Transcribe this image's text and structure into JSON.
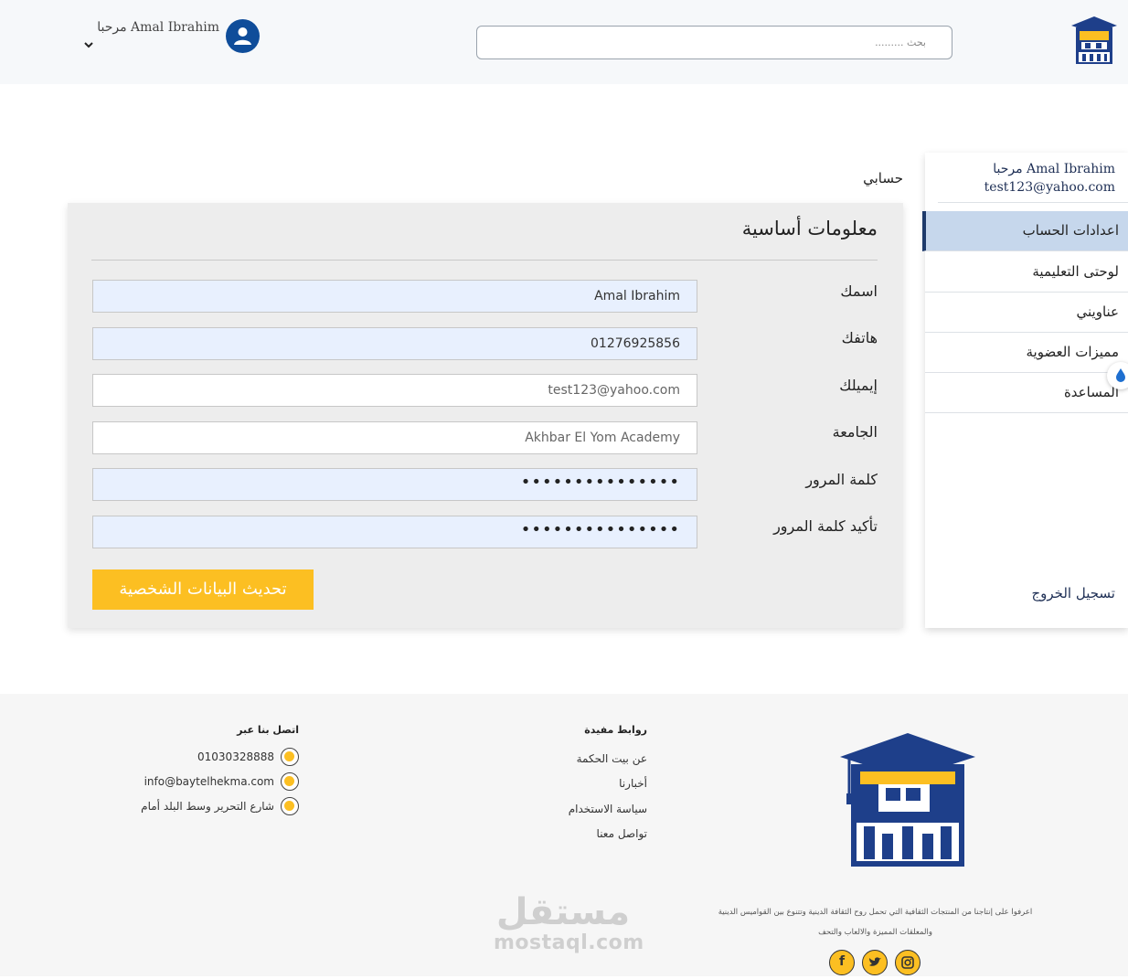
{
  "header": {
    "search_placeholder": "بحث .........",
    "greeting": "مرحبا Amal Ibrahim"
  },
  "sidebar": {
    "name": "مرحبا Amal Ibrahim",
    "email": "test123@yahoo.com",
    "items": [
      {
        "label": "اعدادات الحساب",
        "active": true
      },
      {
        "label": "لوحتى التعليمية",
        "active": false
      },
      {
        "label": "عناويني",
        "active": false
      },
      {
        "label": "مميزات العضوية",
        "active": false
      },
      {
        "label": "المساعدة",
        "active": false
      }
    ],
    "logout": "تسجيل الخروج"
  },
  "main": {
    "section_title": "حسابي",
    "panel_title": "معلومات أساسية",
    "fields": [
      {
        "label": "اسمك",
        "value": "Amal Ibrahim"
      },
      {
        "label": "هاتفك",
        "value": "01276925856"
      },
      {
        "label": "إيميلك",
        "value": "test123@yahoo.com"
      },
      {
        "label": "الجامعة",
        "value": "Akhbar El Yom Academy"
      },
      {
        "label": "كلمة المرور",
        "value": "•••••••••••••••"
      },
      {
        "label": "تأكيد كلمة المرور",
        "value": "•••••••••••••••"
      }
    ],
    "submit_label": "تحديث البيانات الشخصية"
  },
  "footer": {
    "tagline_line1": "اعرفوا على إنتاجنا من المنتجات الثقافية التي تحمل روح الثقافة الدينية وتتنوع بين القواميس الدينية",
    "tagline_line2": "والمعلقات المميزة والالعاب والتحف",
    "links_title": "روابط مفيدة",
    "links": [
      "عن بيت الحكمة",
      "أخبارنا",
      "سياسة الاستخدام",
      "تواصل معنا"
    ],
    "contact_title": "اتصل بنا عبر",
    "phone": "01030328888",
    "email": "info@baytelhekma.com",
    "address": "شارع التحرير وسط البلد أمام",
    "social": [
      "facebook-icon",
      "twitter-icon",
      "instagram-icon"
    ]
  },
  "watermark": {
    "arabic": "مستقل",
    "latin": "mostaql.com"
  },
  "colors": {
    "brand_blue": "#1e3f8a",
    "accent_yellow": "#fcbf22",
    "active_item": "#c6d7ec",
    "avatar_blue": "#0f4d9a"
  }
}
